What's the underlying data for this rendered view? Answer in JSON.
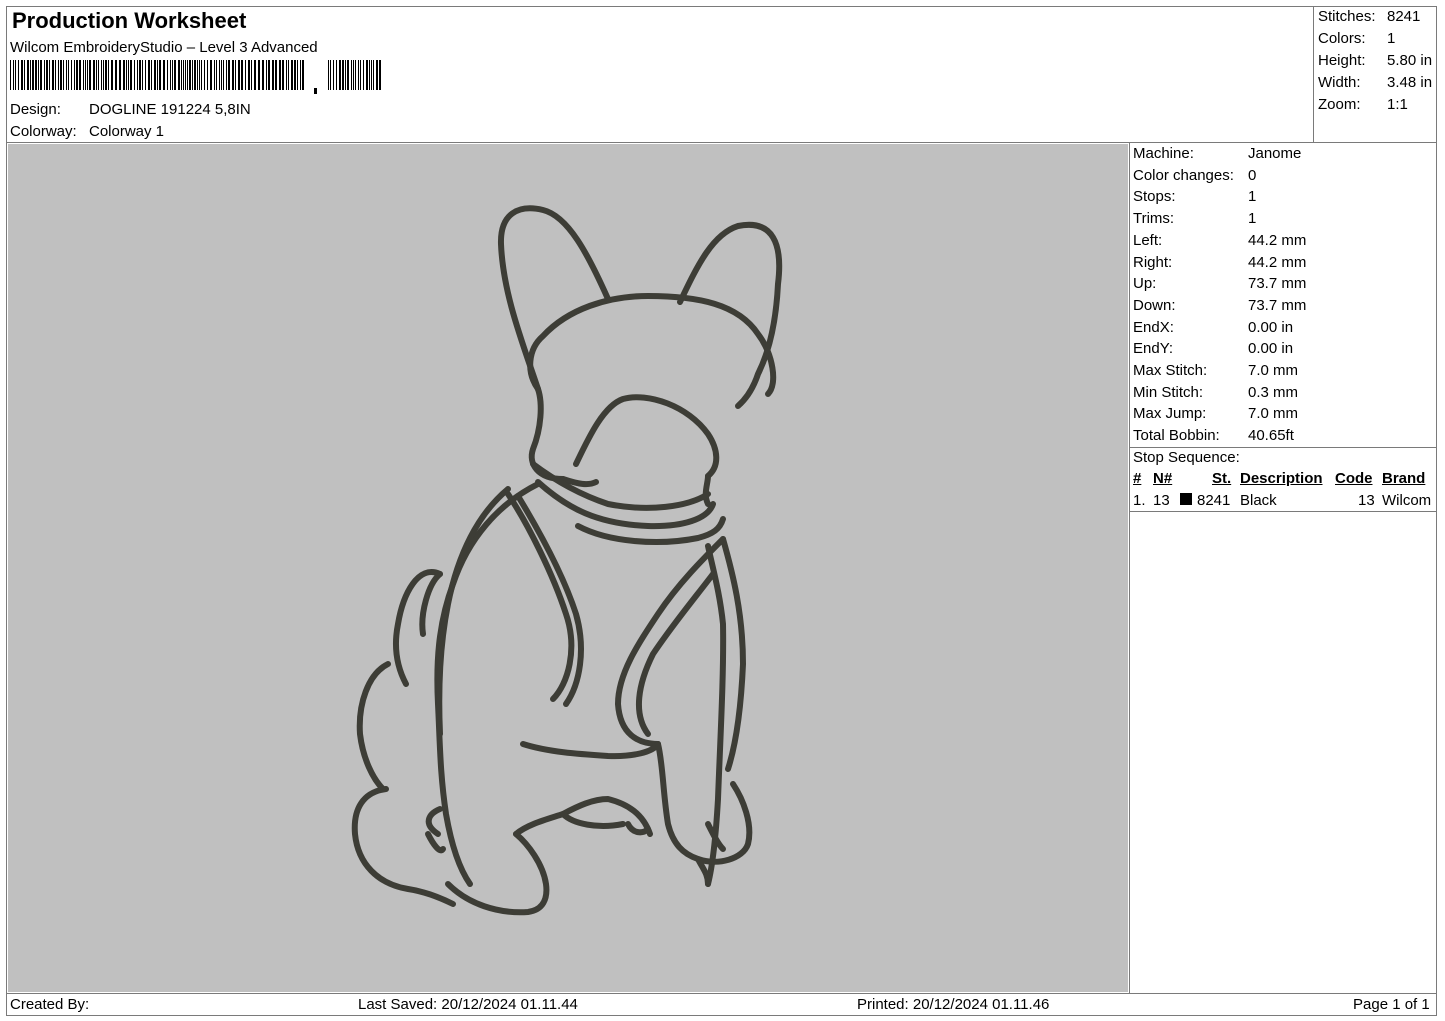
{
  "header": {
    "title": "Production Worksheet",
    "software": "Wilcom EmbroideryStudio – Level 3 Advanced",
    "design_label": "Design:",
    "design_value": "DOGLINE 191224 5,8IN",
    "colorway_label": "Colorway:",
    "colorway_value": "Colorway 1"
  },
  "summary": [
    {
      "label": "Stitches:",
      "value": "8241"
    },
    {
      "label": "Colors:",
      "value": "1"
    },
    {
      "label": "Height:",
      "value": "5.80 in"
    },
    {
      "label": "Width:",
      "value": "3.48 in"
    },
    {
      "label": "Zoom:",
      "value": "1:1"
    }
  ],
  "properties": [
    {
      "label": "Machine:",
      "value": "Janome"
    },
    {
      "label": "Color changes:",
      "value": "0"
    },
    {
      "label": "Stops:",
      "value": "1"
    },
    {
      "label": "Trims:",
      "value": "1"
    },
    {
      "label": "Left:",
      "value": "44.2 mm"
    },
    {
      "label": "Right:",
      "value": "44.2 mm"
    },
    {
      "label": "Up:",
      "value": "73.7 mm"
    },
    {
      "label": "Down:",
      "value": "73.7 mm"
    },
    {
      "label": "EndX:",
      "value": "0.00 in"
    },
    {
      "label": "EndY:",
      "value": "0.00 in"
    },
    {
      "label": "Max Stitch:",
      "value": "7.0 mm"
    },
    {
      "label": "Min Stitch:",
      "value": "0.3 mm"
    },
    {
      "label": "Max Jump:",
      "value": "7.0 mm"
    },
    {
      "label": "Total Bobbin:",
      "value": "40.65ft"
    }
  ],
  "stop_sequence": {
    "title": "Stop Sequence:",
    "headers": {
      "num": "#",
      "n": "N#",
      "st": "St.",
      "description": "Description",
      "code": "Code",
      "brand": "Brand"
    },
    "rows": [
      {
        "num": "1.",
        "n": "13",
        "st": "8241",
        "description": "Black",
        "code": "13",
        "brand": "Wilcom",
        "color": "#1a1a1a"
      }
    ]
  },
  "footer": {
    "created_by": "Created By:",
    "last_saved": "Last Saved: 20/12/2024 01.11.44",
    "printed": "Printed: 20/12/2024 01.11.46",
    "page": "Page 1 of 1"
  },
  "colors": {
    "canvas": "#c0c0c0",
    "thread": "#3d3d36",
    "border": "#7a7a7a"
  }
}
